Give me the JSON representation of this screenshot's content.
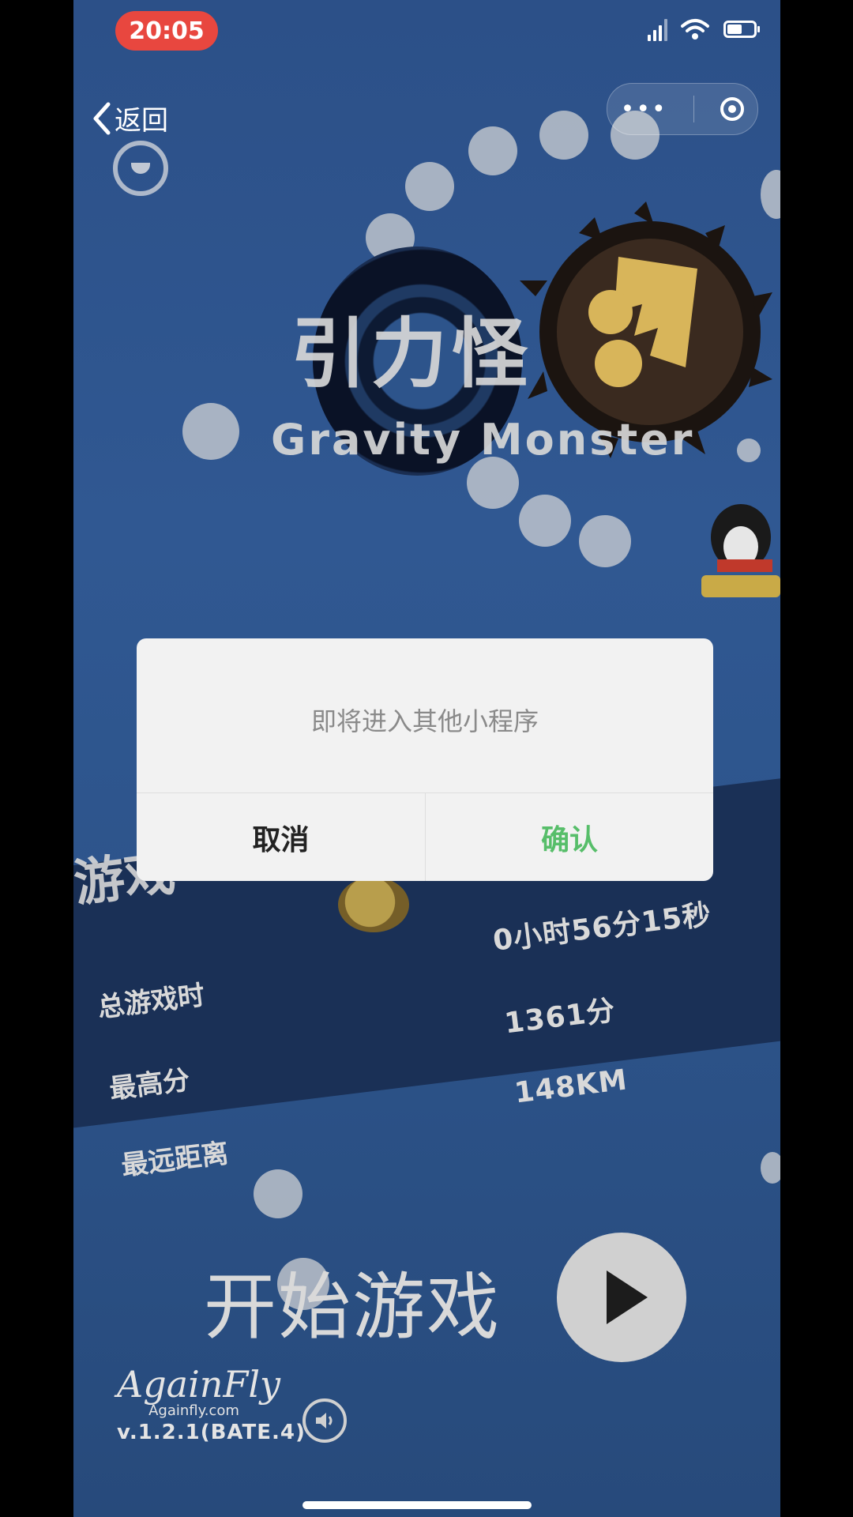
{
  "status_bar": {
    "time": "20:05"
  },
  "nav": {
    "back_label": "返回"
  },
  "game": {
    "title_cn": "引力怪",
    "title_en": "Gravity Monster",
    "stats_heading": "游戏",
    "stats": [
      {
        "label": "总游戏时",
        "value": "0小时56分15秒"
      },
      {
        "label": "最高分",
        "value": "1361分"
      },
      {
        "label": "最远距离",
        "value": "148KM"
      }
    ],
    "start_label": "开始游戏",
    "brand_logo": "AgainFly",
    "brand_site": "Againfly.com",
    "version": "v.1.2.1(BATE.4)"
  },
  "dialog": {
    "message": "即将进入其他小程序",
    "cancel_label": "取消",
    "confirm_label": "确认",
    "confirm_color": "#57be6a"
  },
  "colors": {
    "background": "#2d548b",
    "time_pill": "#e8473f"
  },
  "icons": [
    "back-chevron-icon",
    "more-dots-icon",
    "close-target-icon",
    "play-icon",
    "speaker-icon",
    "wifi-icon",
    "battery-icon",
    "signal-icon"
  ]
}
